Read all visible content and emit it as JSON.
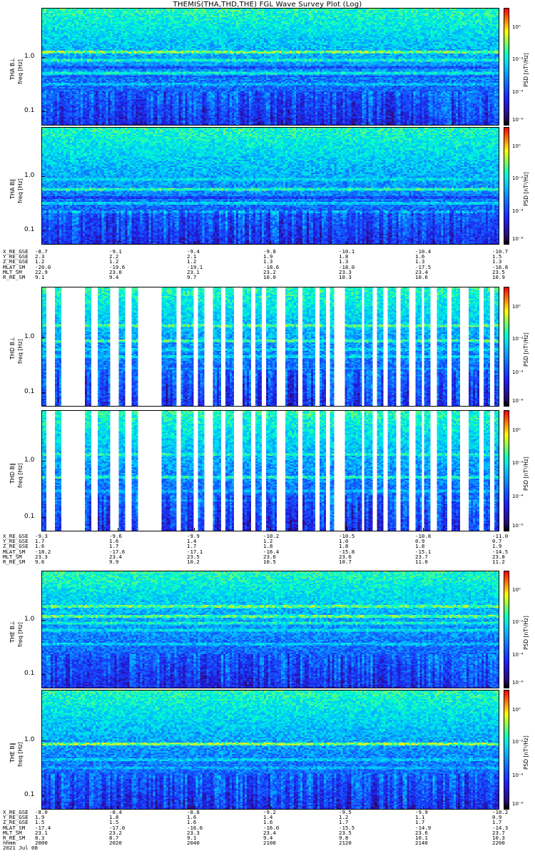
{
  "title": "THEMIS(THA,THD,THE) FGL Wave Survey Plot (Log)",
  "colorbar_ticks": [
    "10⁰",
    "10⁻²",
    "10⁻⁴",
    "10⁻⁶"
  ],
  "colorbar_label": "PSD [nT²/Hz]",
  "freq_ticks": [
    "1.0",
    "0.1"
  ],
  "date_label": "2021 Jul 08",
  "chart_data": [
    {
      "type": "heatmap",
      "probe": "THA",
      "panels": [
        {
          "ylabel": "THA B⊥",
          "sublabel": "freq [Hz]"
        },
        {
          "ylabel": "THA B∥",
          "sublabel": "freq [Hz]"
        }
      ],
      "yscale": "log",
      "ylim": [
        0.05,
        7
      ],
      "gaps": [],
      "ephemeris": {
        "X_RE_GSE": [
          "-8.7",
          "-9.1",
          "-9.4",
          "-9.8",
          "-10.1",
          "-10.4",
          "-10.7"
        ],
        "Y_RE_GSE": [
          "2.3",
          "2.2",
          "2.1",
          "1.9",
          "1.8",
          "1.6",
          "1.5"
        ],
        "Z_RE_GSE": [
          "1.2",
          "1.2",
          "1.2",
          "1.3",
          "1.3",
          "1.3",
          "1.3"
        ],
        "MLAT_SM": [
          "-20.0",
          "-19.6",
          "-19.1",
          "-18.6",
          "-18.0",
          "-17.5",
          "-16.8"
        ],
        "MLT_SM": [
          "22.9",
          "23.0",
          "23.1",
          "23.2",
          "23.3",
          "23.4",
          "23.5"
        ],
        "R_RE_SM": [
          "9.1",
          "9.4",
          "9.7",
          "10.0",
          "10.3",
          "10.6",
          "10.9"
        ]
      }
    },
    {
      "type": "heatmap",
      "probe": "THD",
      "panels": [
        {
          "ylabel": "THD B⊥",
          "sublabel": "freq [Hz]"
        },
        {
          "ylabel": "THD B∥",
          "sublabel": "freq [Hz]"
        }
      ],
      "yscale": "log",
      "ylim": [
        0.05,
        7
      ],
      "gaps": [
        [
          0.005,
          0.025
        ],
        [
          0.04,
          0.09
        ],
        [
          0.105,
          0.12
        ],
        [
          0.145,
          0.165
        ],
        [
          0.18,
          0.195
        ],
        [
          0.21,
          0.26
        ],
        [
          0.29,
          0.3
        ],
        [
          0.33,
          0.34
        ],
        [
          0.355,
          0.37
        ],
        [
          0.39,
          0.4
        ],
        [
          0.42,
          0.435
        ],
        [
          0.455,
          0.465
        ],
        [
          0.48,
          0.49
        ],
        [
          0.51,
          0.53
        ],
        [
          0.56,
          0.57
        ],
        [
          0.595,
          0.605
        ],
        [
          0.62,
          0.63
        ],
        [
          0.64,
          0.66
        ],
        [
          0.7,
          0.705
        ],
        [
          0.72,
          0.73
        ],
        [
          0.745,
          0.755
        ],
        [
          0.775,
          0.785
        ],
        [
          0.8,
          0.815
        ],
        [
          0.83,
          0.835
        ],
        [
          0.85,
          0.86
        ],
        [
          0.885,
          0.895
        ],
        [
          0.915,
          0.93
        ],
        [
          0.955,
          0.965
        ],
        [
          0.98,
          0.99
        ]
      ],
      "ephemeris": {
        "X_RE_GSE": [
          "-9.3",
          "-9.6",
          "-9.9",
          "-10.2",
          "-10.5",
          "-10.8",
          "-11.0"
        ],
        "Y_RE_GSE": [
          "1.7",
          "1.6",
          "1.4",
          "1.2",
          "1.0",
          "0.9",
          "0.7"
        ],
        "Z_RE_GSE": [
          "1.6",
          "1.7",
          "1.7",
          "1.8",
          "1.8",
          "1.8",
          "1.9"
        ],
        "MLAT_SM": [
          "-18.2",
          "-17.6",
          "-17.1",
          "-16.4",
          "-15.8",
          "-15.1",
          "-14.5"
        ],
        "MLT_SM": [
          "23.3",
          "23.4",
          "23.5",
          "23.6",
          "23.6",
          "23.7",
          "23.8"
        ],
        "R_RE_SM": [
          "9.6",
          "9.9",
          "10.2",
          "10.5",
          "10.7",
          "11.0",
          "11.2"
        ]
      }
    },
    {
      "type": "heatmap",
      "probe": "THE",
      "panels": [
        {
          "ylabel": "THE B⊥",
          "sublabel": "freq [Hz]"
        },
        {
          "ylabel": "THE B∥",
          "sublabel": "freq [Hz]"
        }
      ],
      "yscale": "log",
      "ylim": [
        0.05,
        7
      ],
      "gaps": [],
      "ephemeris": {
        "X_RE_GSE": [
          "-8.0",
          "-8.4",
          "-8.8",
          "-9.2",
          "-9.5",
          "-9.9",
          "-10.2"
        ],
        "Y_RE_GSE": [
          "1.9",
          "1.8",
          "1.6",
          "1.4",
          "1.2",
          "1.1",
          "0.9"
        ],
        "Z_RE_GSE": [
          "1.5",
          "1.5",
          "1.6",
          "1.6",
          "1.7",
          "1.7",
          "1.7"
        ],
        "MLAT_SM": [
          "-17.4",
          "-17.0",
          "-16.6",
          "-16.0",
          "-15.5",
          "-14.9",
          "-14.3"
        ],
        "MLT_SM": [
          "23.1",
          "23.2",
          "23.3",
          "23.4",
          "23.5",
          "23.6",
          "23.7"
        ],
        "R_RE_SM": [
          "8.3",
          "8.7",
          "9.1",
          "9.4",
          "9.8",
          "10.1",
          "10.3"
        ],
        "hhmm": [
          "2000",
          "2020",
          "2040",
          "2100",
          "2120",
          "2140",
          "2200"
        ]
      }
    }
  ]
}
